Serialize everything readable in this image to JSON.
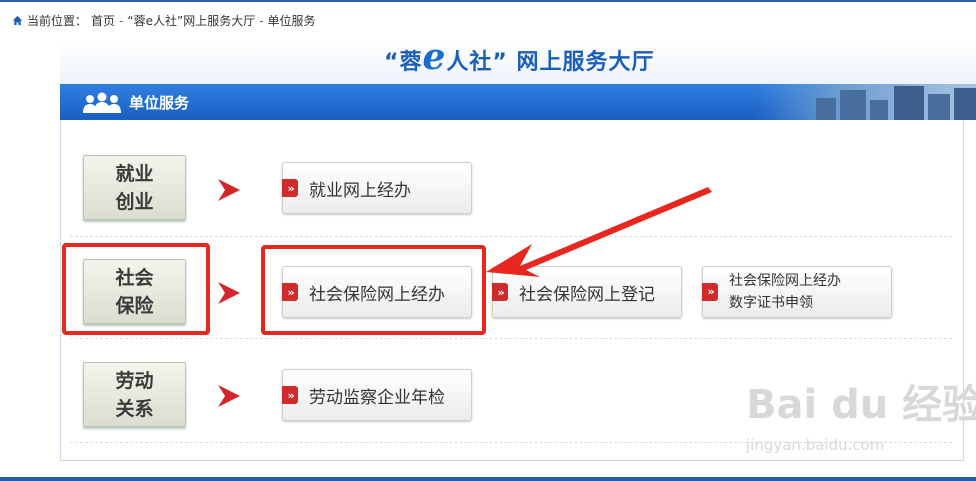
{
  "breadcrumb": {
    "prefix": "当前位置：",
    "items": [
      "首页",
      "“蓉e人社”网上服务大厅",
      "单位服务"
    ],
    "separator": "-"
  },
  "hall_title": {
    "open_quote": "“蓉",
    "e_letter": "e",
    "rest": "人社” 网上服务大厅"
  },
  "section_title": "单位服务",
  "categories": [
    {
      "line1": "就业",
      "line2": "创业"
    },
    {
      "line1": "社会",
      "line2": "保险"
    },
    {
      "line1": "劳动",
      "line2": "关系"
    }
  ],
  "buttons": {
    "employment_online": "就业网上经办",
    "social_insurance_online": "社会保险网上经办",
    "social_insurance_register": "社会保险网上登记",
    "social_cert_line1": "社会保险网上经办",
    "social_cert_line2": "数字证书申领",
    "labor_inspection": "劳动监察企业年检"
  },
  "watermark": {
    "brand": "Bai du 经验",
    "url": "jingyan.baidu.com"
  },
  "colors": {
    "accent_blue": "#1b5fb8",
    "highlight_red": "#e8281f",
    "marker_red": "#d02b2b"
  }
}
